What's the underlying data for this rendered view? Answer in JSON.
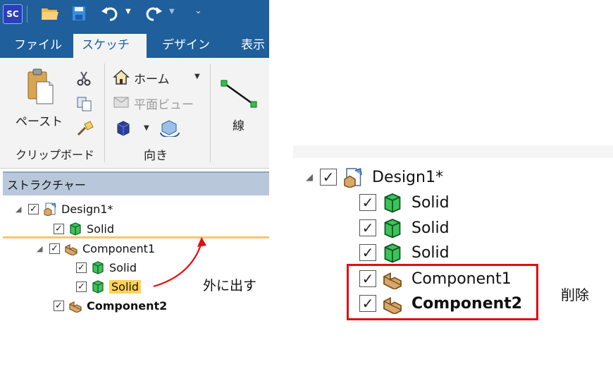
{
  "qat": {
    "logo": "SC",
    "icons": [
      "open-folder-icon",
      "save-icon",
      "undo-icon",
      "redo-icon",
      "customize-icon"
    ]
  },
  "tabs": [
    {
      "label": "ファイル",
      "active": false
    },
    {
      "label": "スケッチ",
      "active": true
    },
    {
      "label": "デザイン",
      "active": false
    },
    {
      "label": "表示",
      "active": false
    }
  ],
  "ribbon": {
    "clipboard": {
      "paste_label": "ペースト",
      "group_label": "クリップボード"
    },
    "orient": {
      "home_label": "ホーム",
      "plane_view_label": "平面ビュー",
      "group_label": "向き"
    },
    "line_label": "線"
  },
  "structure": {
    "header": "ストラクチャー",
    "tree": [
      {
        "label": "Design1*",
        "level": 0,
        "expanded": true,
        "checked": true,
        "icon": "design-icon",
        "bold": false,
        "selected": false
      },
      {
        "label": "Solid",
        "level": 1,
        "checked": true,
        "icon": "solid-icon",
        "bold": false,
        "selected": false
      },
      {
        "label": "Component1",
        "level": 1,
        "expanded": true,
        "checked": true,
        "icon": "component-icon",
        "bold": false,
        "selected": false
      },
      {
        "label": "Solid",
        "level": 2,
        "checked": true,
        "icon": "solid-icon",
        "bold": false,
        "selected": false
      },
      {
        "label": "Solid",
        "level": 2,
        "checked": true,
        "icon": "solid-icon",
        "bold": false,
        "selected": true
      },
      {
        "label": "Component2",
        "level": 1,
        "checked": true,
        "icon": "component-icon",
        "bold": true,
        "selected": false
      }
    ]
  },
  "annotations": {
    "move_out": "外に出す",
    "delete": "削除",
    "arrow_color": "#e01010",
    "box_color": "#e01010",
    "drop_line_color": "#f7c766"
  },
  "result": {
    "tree": [
      {
        "label": "Design1*",
        "icon": "design-icon",
        "bold": false
      },
      {
        "label": "Solid",
        "icon": "solid-icon",
        "bold": false
      },
      {
        "label": "Solid",
        "icon": "solid-icon",
        "bold": false
      },
      {
        "label": "Solid",
        "icon": "solid-icon",
        "bold": false
      },
      {
        "label": "Component1",
        "icon": "component-icon",
        "bold": false
      },
      {
        "label": "Component2",
        "icon": "component-icon",
        "bold": true
      }
    ]
  }
}
